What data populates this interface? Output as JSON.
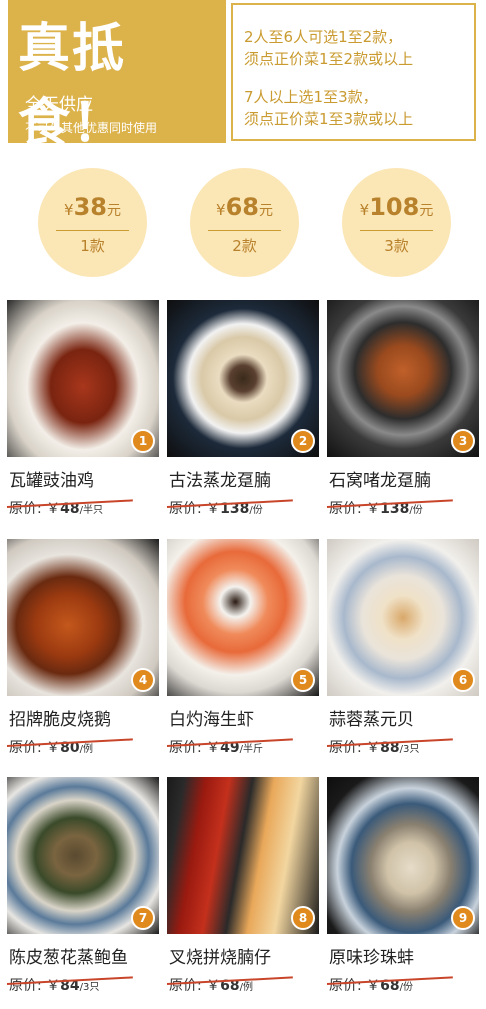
{
  "banner": {
    "title": "真抵食！",
    "subtitle": "全天供应",
    "note": "不可与其他优惠同时使用",
    "rules": [
      "2人至6人可选1至2款，",
      "须点正价菜1至2款或以上",
      "7人以上选1至3款，",
      "须点正价菜1至3款或以上"
    ]
  },
  "tiers": [
    {
      "yen": "¥",
      "price": "38",
      "unit": "元",
      "count": "1款"
    },
    {
      "yen": "¥",
      "price": "68",
      "unit": "元",
      "count": "2款"
    },
    {
      "yen": "¥",
      "price": "108",
      "unit": "元",
      "count": "3款"
    }
  ],
  "dishes": [
    {
      "num": "1",
      "name": "瓦罐豉油鸡",
      "label": "原价:",
      "yen": "￥",
      "price": "48",
      "unit": "/半只"
    },
    {
      "num": "2",
      "name": "古法蒸龙趸腩",
      "label": "原价:",
      "yen": "￥",
      "price": "138",
      "unit": "/份"
    },
    {
      "num": "3",
      "name": "石窝啫龙趸腩",
      "label": "原价:",
      "yen": "￥",
      "price": "138",
      "unit": "/份"
    },
    {
      "num": "4",
      "name": "招牌脆皮烧鹅",
      "label": "原价:",
      "yen": "￥",
      "price": "80",
      "unit": "/例"
    },
    {
      "num": "5",
      "name": "白灼海生虾",
      "label": "原价:",
      "yen": "￥",
      "price": "49",
      "unit": "/半斤"
    },
    {
      "num": "6",
      "name": "蒜蓉蒸元贝",
      "label": "原价:",
      "yen": "￥",
      "price": "88",
      "unit": "/3只"
    },
    {
      "num": "7",
      "name": "陈皮葱花蒸鲍鱼",
      "label": "原价:",
      "yen": "￥",
      "price": "84",
      "unit": "/3只"
    },
    {
      "num": "8",
      "name": "叉烧拼烧腩仔",
      "label": "原价:",
      "yen": "￥",
      "price": "68",
      "unit": "/例"
    },
    {
      "num": "9",
      "name": "原味珍珠蚌",
      "label": "原价:",
      "yen": "￥",
      "price": "68",
      "unit": "/份"
    }
  ],
  "colors": {
    "gold": "#dcb24a",
    "circle": "#fbe6b6",
    "badge": "#e08a1d",
    "strike": "#c8452a"
  }
}
